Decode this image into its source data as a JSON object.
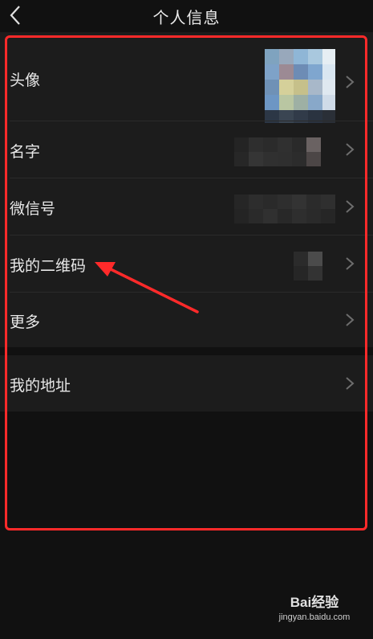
{
  "header": {
    "title": "个人信息",
    "back_icon": "chevron-left-icon"
  },
  "rows": [
    {
      "label": "头像",
      "value_type": "avatar",
      "chevron": "chevron-right-icon"
    },
    {
      "label": "名字",
      "value_type": "blurred-text",
      "chevron": "chevron-right-icon"
    },
    {
      "label": "微信号",
      "value_type": "blurred-text",
      "chevron": "chevron-right-icon"
    },
    {
      "label": "我的二维码",
      "value_type": "qr-thumbnail",
      "chevron": "chevron-right-icon"
    },
    {
      "label": "更多",
      "value_type": "none",
      "chevron": "chevron-right-icon"
    }
  ],
  "rows2": [
    {
      "label": "我的地址",
      "value_type": "none",
      "chevron": "chevron-right-icon"
    }
  ],
  "annotation": {
    "box_color": "#ff2a2a",
    "arrow_color": "#ff2a2a"
  },
  "watermark": {
    "brand": "Bai经验",
    "url": "jingyan.baidu.com"
  },
  "colors": {
    "background": "#111111",
    "row_background": "#1c1c1c",
    "text": "#e8e8e8"
  }
}
